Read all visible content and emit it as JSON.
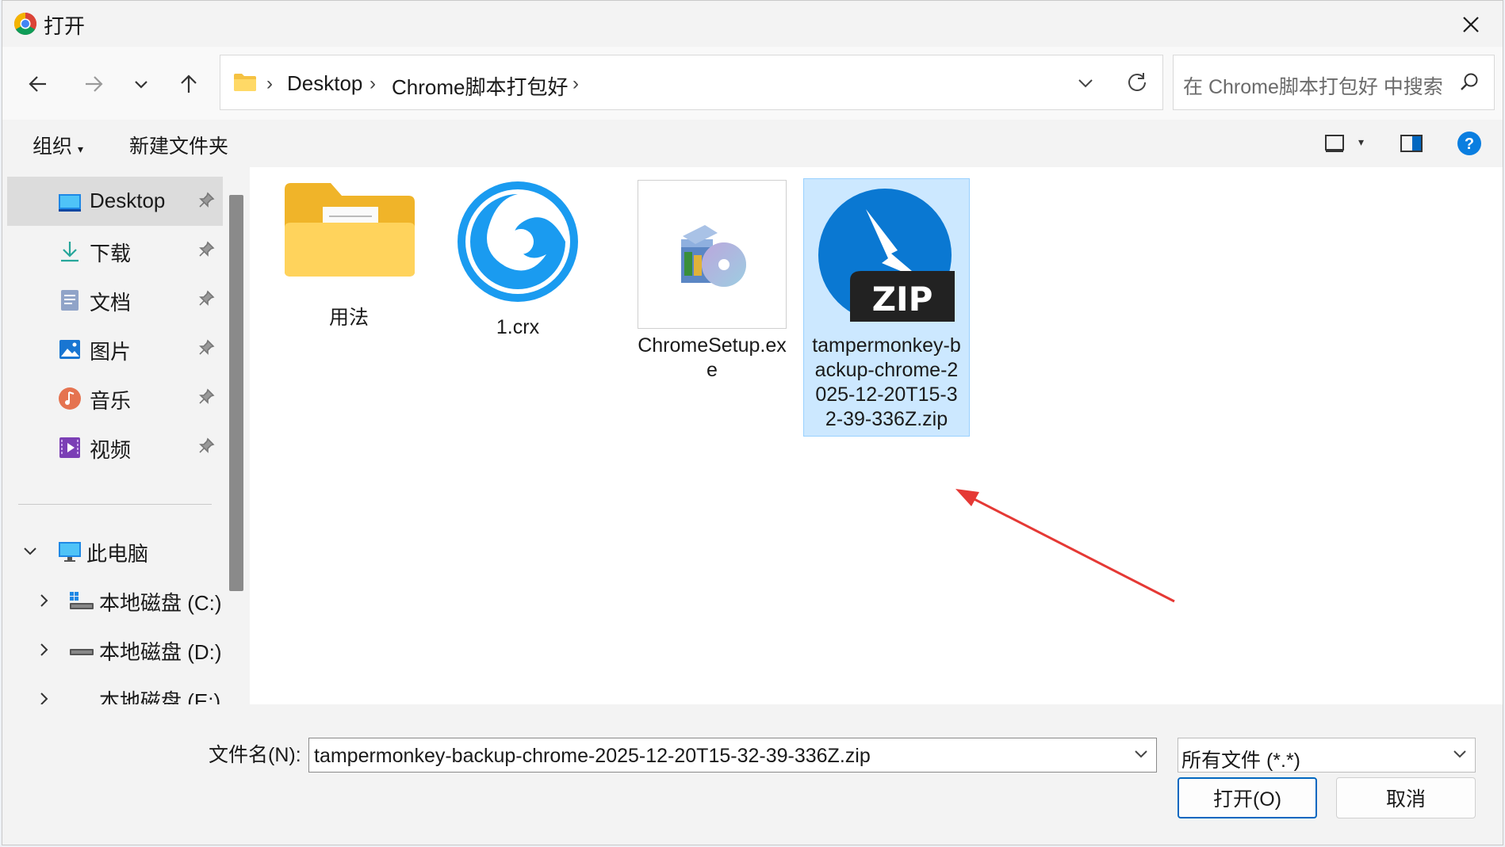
{
  "window": {
    "title": "打开"
  },
  "nav": {
    "breadcrumbs": [
      "Desktop",
      "Chrome脚本打包好"
    ],
    "search_placeholder": "在 Chrome脚本打包好 中搜索"
  },
  "commands": {
    "organize": "组织",
    "new_folder": "新建文件夹"
  },
  "sidebar": {
    "quick_access": [
      {
        "label": "Desktop",
        "icon": "desktop-icon",
        "pinned": true,
        "active": true
      },
      {
        "label": "下载",
        "icon": "download-icon",
        "pinned": true
      },
      {
        "label": "文档",
        "icon": "documents-icon",
        "pinned": true
      },
      {
        "label": "图片",
        "icon": "pictures-icon",
        "pinned": true
      },
      {
        "label": "音乐",
        "icon": "music-icon",
        "pinned": true
      },
      {
        "label": "视频",
        "icon": "videos-icon",
        "pinned": true
      }
    ],
    "this_pc": "此电脑",
    "drives": [
      "本地磁盘 (C:)",
      "本地磁盘 (D:)"
    ],
    "partial_drive": "本地磁盘 (E:)"
  },
  "files": [
    {
      "name": "用法",
      "icon": "folder-icon"
    },
    {
      "name": "1.crx",
      "icon": "crx-icon"
    },
    {
      "name": "ChromeSetup.exe",
      "icon": "installer-icon"
    },
    {
      "name": "tampermonkey-backup-chrome-2025-12-20T15-32-39-336Z.zip",
      "icon": "zip-icon",
      "selected": true
    }
  ],
  "footer": {
    "filename_label": "文件名(N):",
    "filename_value": "tampermonkey-backup-chrome-2025-12-20T15-32-39-336Z.zip",
    "filetype_value": "所有文件 (*.*)",
    "open_button": "打开(O)",
    "cancel_button": "取消"
  },
  "colors": {
    "selection": "#cce8ff",
    "accent": "#0067c0",
    "annotation_arrow": "#e53935"
  }
}
